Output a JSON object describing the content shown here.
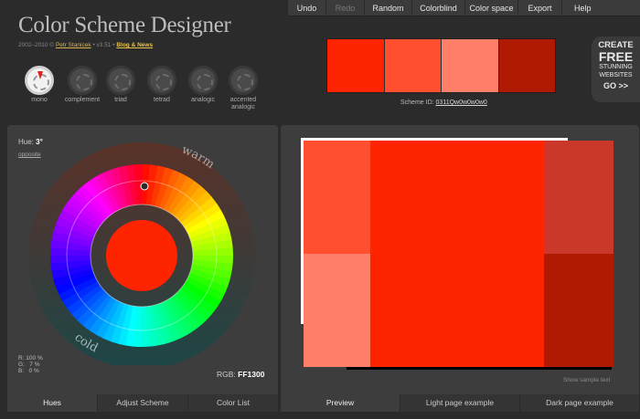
{
  "menu": [
    "Undo",
    "Redo",
    "Random",
    "Colorblind",
    "Color space",
    "Export",
    "Help"
  ],
  "header": {
    "title": "Color Scheme Designer",
    "credits_prefix": "2002–2010 ©",
    "author": "Petr Stanicek",
    "version": "• v3.51 •",
    "blog": "Blog & News"
  },
  "scheme_types": [
    "mono",
    "complement",
    "triad",
    "tetrad",
    "analogic",
    "accented analogic"
  ],
  "swatches": [
    "#ff2400",
    "#ff4f2e",
    "#ff7f6b",
    "#b01a02"
  ],
  "scheme_id": {
    "label": "Scheme ID:",
    "value": "0311Qw0w0w0w0"
  },
  "promo": {
    "line1": "CREATE",
    "line2": "FREE",
    "line3": "STUNNING",
    "line4": "WEBSITES",
    "line5": "GO >>"
  },
  "wheel": {
    "hue_label": "Hue:",
    "hue_value": "3°",
    "opposite": "opposite",
    "warm": "warm",
    "cold": "cold",
    "rgb_percent": [
      "R: 100 %",
      "G:   7 %",
      "B:   0 %"
    ],
    "rgb_label": "RGB:",
    "rgb_value": "FF1300",
    "main_color": "#ff2400"
  },
  "left_tabs": [
    "Hues",
    "Adjust Scheme",
    "Color List"
  ],
  "right_tabs": [
    "Preview",
    "Light page example",
    "Dark page example"
  ],
  "preview": {
    "colors": {
      "main": "#ff2400",
      "light": "#ff4f2e",
      "lighter": "#ff7f6b",
      "mid_dark": "#c9382a",
      "dark": "#b01a02"
    },
    "show_sample": "Show sample text"
  }
}
